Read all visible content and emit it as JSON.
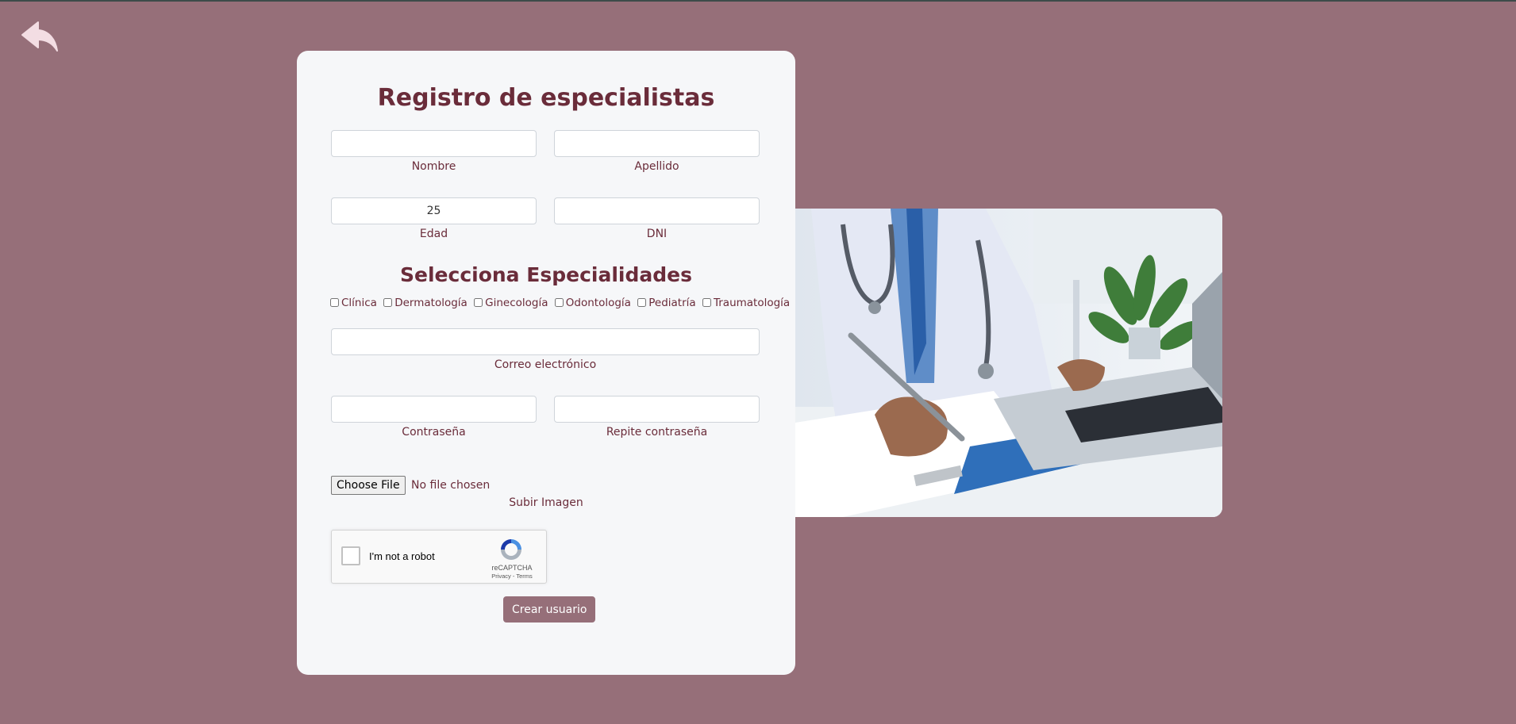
{
  "back": {
    "icon": "reply-arrow-icon"
  },
  "form": {
    "title": "Registro de especialistas",
    "nombre": {
      "label": "Nombre",
      "value": ""
    },
    "apellido": {
      "label": "Apellido",
      "value": ""
    },
    "edad": {
      "label": "Edad",
      "value": "25"
    },
    "dni": {
      "label": "DNI",
      "value": ""
    },
    "specialties_title": "Selecciona Especialidades",
    "specialties": [
      "Clínica",
      "Dermatología",
      "Ginecología",
      "Odontología",
      "Pediatría",
      "Traumatología"
    ],
    "correo": {
      "label": "Correo electrónico",
      "value": ""
    },
    "password": {
      "label": "Contraseña",
      "value": ""
    },
    "password_repeat": {
      "label": "Repite contraseña",
      "value": ""
    },
    "file": {
      "button": "Choose File",
      "status": "No file chosen",
      "label": "Subir Imagen"
    },
    "captcha": {
      "text": "I'm not a robot",
      "brand": "reCAPTCHA",
      "links": "Privacy - Terms"
    },
    "submit": "Crear usuario"
  },
  "colors": {
    "background": "#966f79",
    "card": "#f6f7f9",
    "text": "#6a2c3a",
    "button": "#966f79"
  },
  "image": {
    "icon": "doctor-at-laptop-photo"
  }
}
